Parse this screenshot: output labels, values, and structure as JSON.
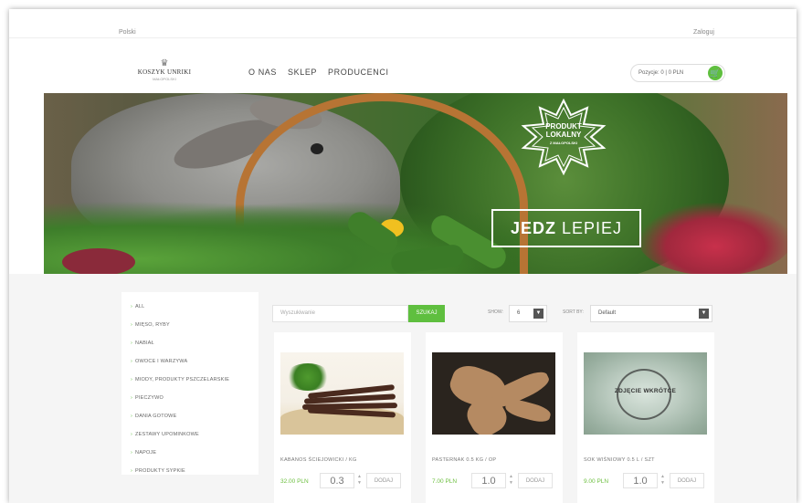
{
  "topbar": {
    "language": "Polski",
    "login": "Zaloguj"
  },
  "logo": {
    "name": "KOSZYK UNRIKI",
    "tagline": "MAŁOPOLSKI"
  },
  "nav": {
    "items": [
      "O NAS",
      "SKLEP",
      "PRODUCENCI"
    ]
  },
  "cart": {
    "label": "Pozycje: 0 | 0 PLN",
    "icon": "cart-icon",
    "accent": "#5fbf3f"
  },
  "hero": {
    "badge": {
      "line1": "PRODUKT",
      "line2": "LOKALNY",
      "line3": "Z MAŁOPOLSKI"
    },
    "slogan_bold": "JEDZ",
    "slogan_rest": "LEPIEJ"
  },
  "sidebar": {
    "categories": [
      "ALL",
      "MIĘSO, RYBY",
      "NABIAŁ",
      "OWOCE I WARZYWA",
      "MIODY, PRODUKTY PSZCZELARSKIE",
      "PIECZYWO",
      "DANIA GOTOWE",
      "ZESTAWY UPOMINKOWE",
      "NAPOJE",
      "PRODUKTY SYPKIE"
    ]
  },
  "toolbar": {
    "search_placeholder": "Wyszukiwanie",
    "search_button": "SZUKAJ",
    "show_label": "SHOW:",
    "show_value": "6",
    "sortby_label": "SORT BY:",
    "sort_value": "Default"
  },
  "products": [
    {
      "name": "KABANOS ŚCIEJOWICKI / KG",
      "price": "32.00 PLN",
      "qty": "0.3",
      "add": "DODAJ"
    },
    {
      "name": "PASTERNAK 0.5 KG / OP",
      "price": "7.00 PLN",
      "qty": "1.0",
      "add": "DODAJ"
    },
    {
      "name": "SOK WIŚNIOWY 0.5 L / SZT",
      "price": "9.00 PLN",
      "qty": "1.0",
      "add": "DODAJ",
      "image_text": "ZDJĘCIE WKRÓTCE"
    }
  ]
}
